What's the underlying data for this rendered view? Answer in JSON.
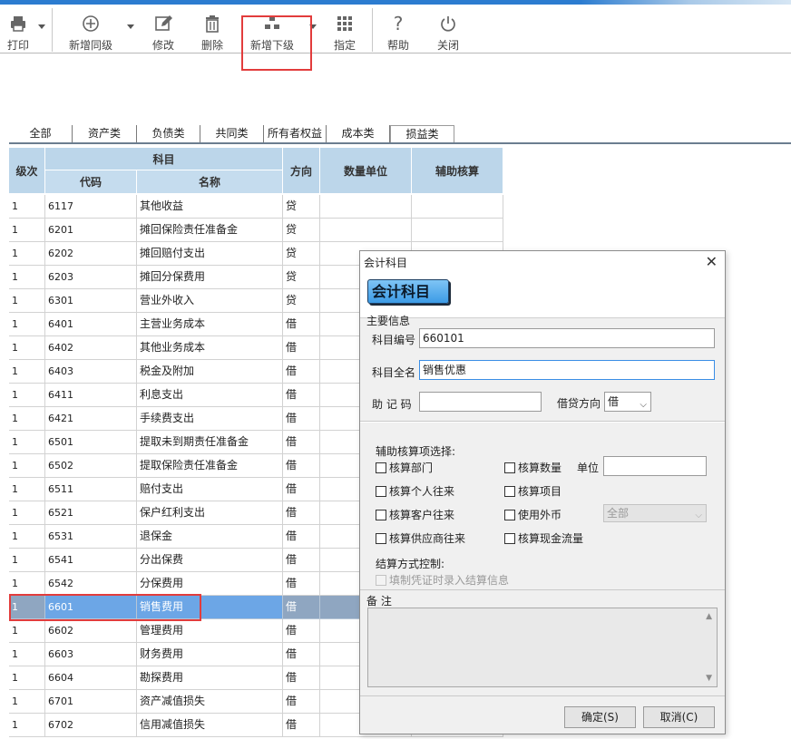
{
  "toolbar": {
    "print": "打印",
    "add_same": "新增同级",
    "edit": "修改",
    "delete": "删除",
    "add_sub": "新增下级",
    "assign": "指定",
    "help": "帮助",
    "close": "关闭"
  },
  "tabs": [
    "全部",
    "资产类",
    "负债类",
    "共同类",
    "所有者权益",
    "成本类",
    "损益类"
  ],
  "active_tab": "损益类",
  "grid": {
    "headers": {
      "level": "级次",
      "subject": "科目",
      "code": "代码",
      "name": "名称",
      "direction": "方向",
      "unit": "数量单位",
      "aux": "辅助核算"
    },
    "rows": [
      {
        "level": "1",
        "code": "6117",
        "name": "其他收益",
        "dir": "贷"
      },
      {
        "level": "1",
        "code": "6201",
        "name": "摊回保险责任准备金",
        "dir": "贷"
      },
      {
        "level": "1",
        "code": "6202",
        "name": "摊回赔付支出",
        "dir": "贷"
      },
      {
        "level": "1",
        "code": "6203",
        "name": "摊回分保费用",
        "dir": "贷"
      },
      {
        "level": "1",
        "code": "6301",
        "name": "营业外收入",
        "dir": "贷"
      },
      {
        "level": "1",
        "code": "6401",
        "name": "主营业务成本",
        "dir": "借"
      },
      {
        "level": "1",
        "code": "6402",
        "name": "其他业务成本",
        "dir": "借"
      },
      {
        "level": "1",
        "code": "6403",
        "name": "税金及附加",
        "dir": "借"
      },
      {
        "level": "1",
        "code": "6411",
        "name": "利息支出",
        "dir": "借"
      },
      {
        "level": "1",
        "code": "6421",
        "name": "手续费支出",
        "dir": "借"
      },
      {
        "level": "1",
        "code": "6501",
        "name": "提取未到期责任准备金",
        "dir": "借"
      },
      {
        "level": "1",
        "code": "6502",
        "name": "提取保险责任准备金",
        "dir": "借"
      },
      {
        "level": "1",
        "code": "6511",
        "name": "赔付支出",
        "dir": "借"
      },
      {
        "level": "1",
        "code": "6521",
        "name": "保户红利支出",
        "dir": "借"
      },
      {
        "level": "1",
        "code": "6531",
        "name": "退保金",
        "dir": "借"
      },
      {
        "level": "1",
        "code": "6541",
        "name": "分出保费",
        "dir": "借"
      },
      {
        "level": "1",
        "code": "6542",
        "name": "分保费用",
        "dir": "借"
      },
      {
        "level": "1",
        "code": "6601",
        "name": "销售费用",
        "dir": "借",
        "selected": true
      },
      {
        "level": "1",
        "code": "6602",
        "name": "管理费用",
        "dir": "借"
      },
      {
        "level": "1",
        "code": "6603",
        "name": "财务费用",
        "dir": "借"
      },
      {
        "level": "1",
        "code": "6604",
        "name": "勘探费用",
        "dir": "借"
      },
      {
        "level": "1",
        "code": "6701",
        "name": "资产减值损失",
        "dir": "借"
      },
      {
        "level": "1",
        "code": "6702",
        "name": "信用减值损失",
        "dir": "借"
      }
    ]
  },
  "dialog": {
    "title": "会计科目",
    "close": "✕",
    "badge": "会计科目",
    "main_info": "主要信息",
    "code_label": "科目编号",
    "code_value": "660101",
    "fullname_label": "科目全名",
    "fullname_value": "销售优惠",
    "mnemonic_label": "助 记 码",
    "mnemonic_value": "",
    "direction_label": "借贷方向",
    "direction_value": "借",
    "aux_title": "辅助核算项选择:",
    "checks": {
      "dept": "核算部门",
      "qty": "核算数量",
      "person": "核算个人往来",
      "project": "核算项目",
      "customer": "核算客户往来",
      "foreign": "使用外币",
      "supplier": "核算供应商往来",
      "cashflow": "核算现金流量"
    },
    "unit_label": "单位",
    "unit_value": "",
    "currency_value": "全部",
    "settle_title": "结算方式控制:",
    "settle_check": "填制凭证时录入结算信息",
    "memo_label": "备    注",
    "ok": "确定(S)",
    "cancel": "取消(C)"
  }
}
